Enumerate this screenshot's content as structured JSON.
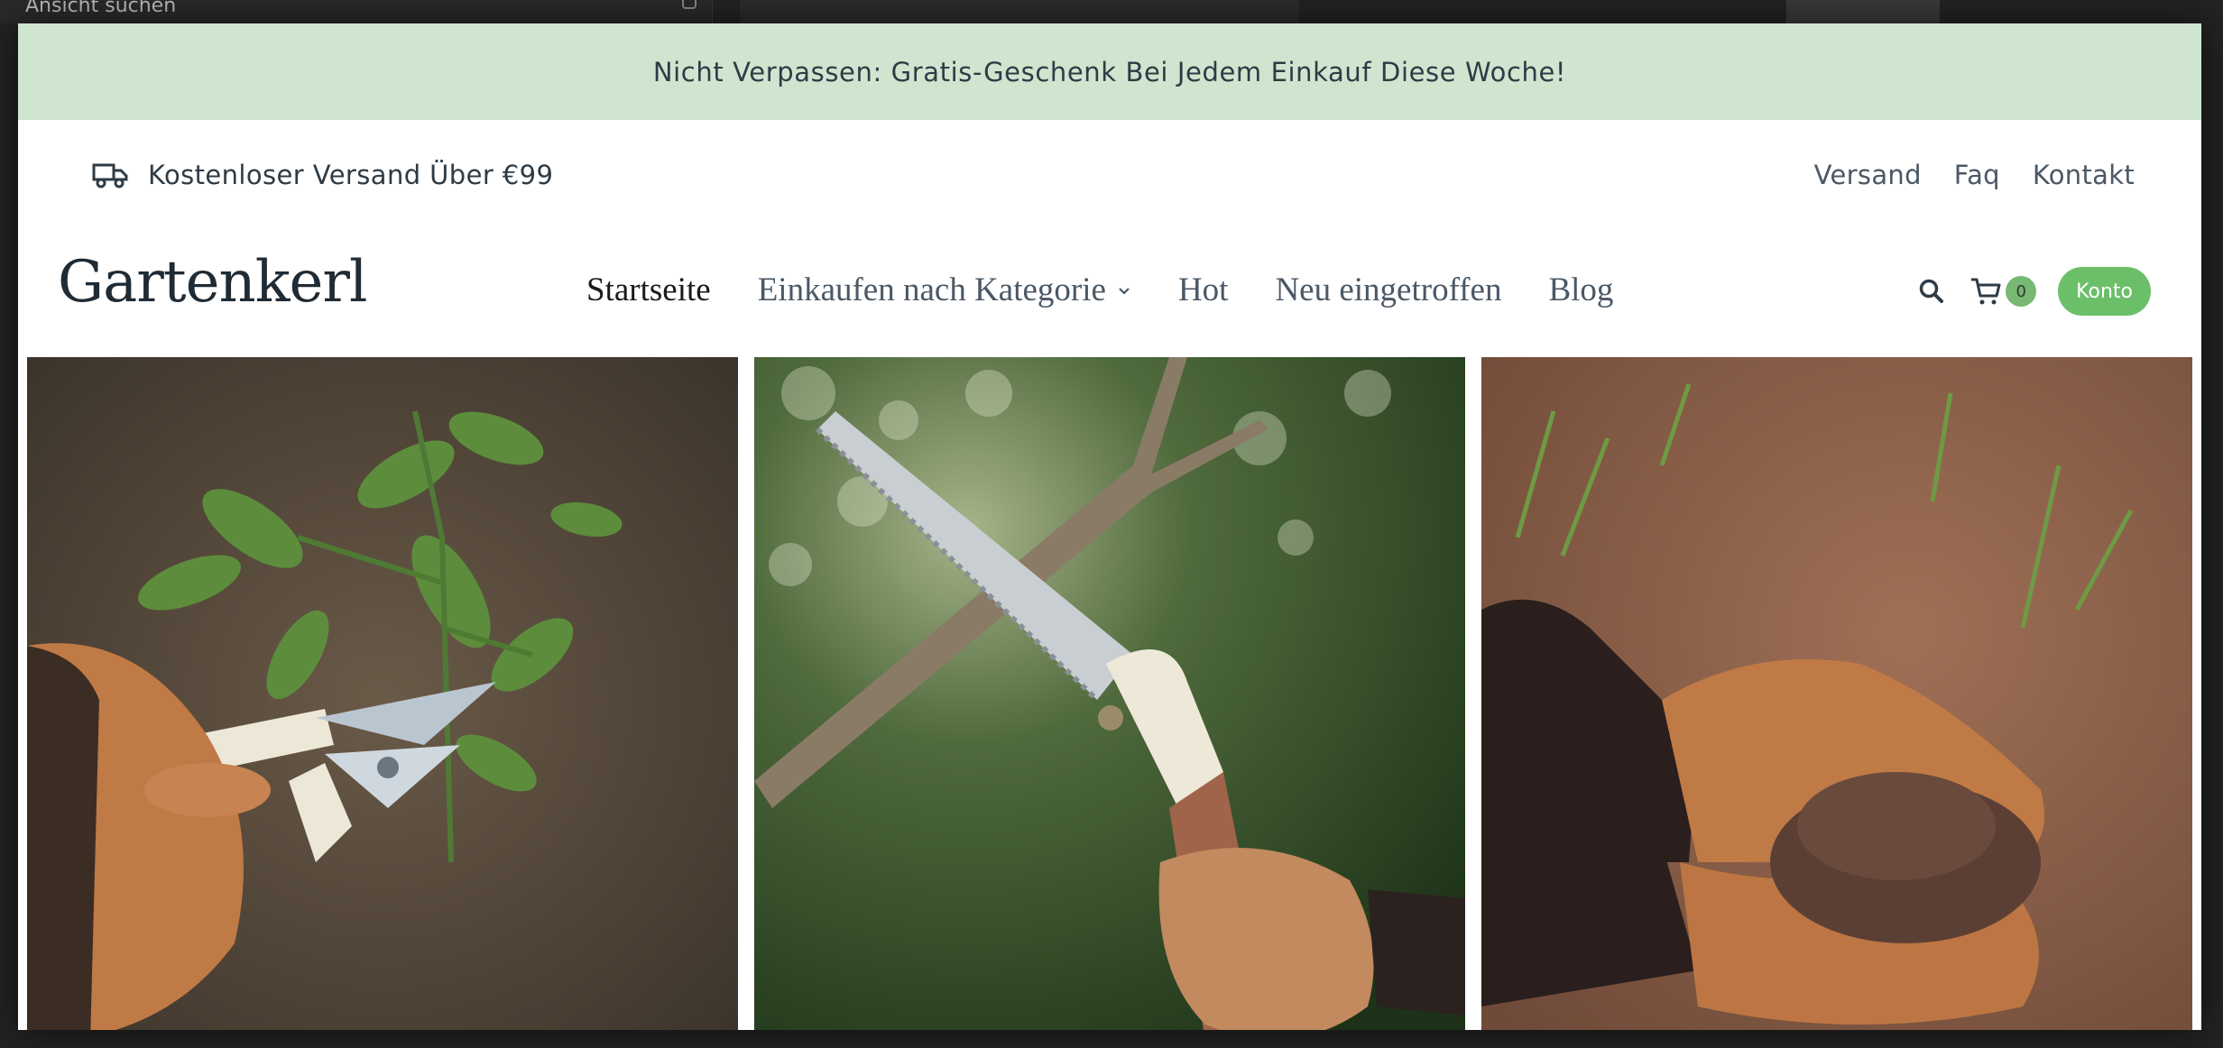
{
  "backdrop": {
    "search_label": "Ansicht suchen"
  },
  "announcement": {
    "text": "Nicht Verpassen: Gratis-Geschenk Bei Jedem Einkauf Diese Woche!",
    "background": "#cfe5cf"
  },
  "topbar": {
    "shipping_text": "Kostenloser Versand Über €99",
    "links": [
      "Versand",
      "Faq",
      "Kontakt"
    ]
  },
  "header": {
    "logo": "Gartenkerl",
    "nav": [
      {
        "label": "Startseite",
        "active": true
      },
      {
        "label": "Einkaufen nach Kategorie",
        "dropdown": true
      },
      {
        "label": "Hot"
      },
      {
        "label": "Neu eingetroffen"
      },
      {
        "label": "Blog"
      }
    ],
    "cart_count": "0",
    "account_label": "Konto",
    "accent_color": "#6cbf69"
  },
  "tiles": [
    {
      "icon": "pruning-shears-image"
    },
    {
      "icon": "folding-saw-image"
    },
    {
      "icon": "soil-hands-image"
    }
  ]
}
